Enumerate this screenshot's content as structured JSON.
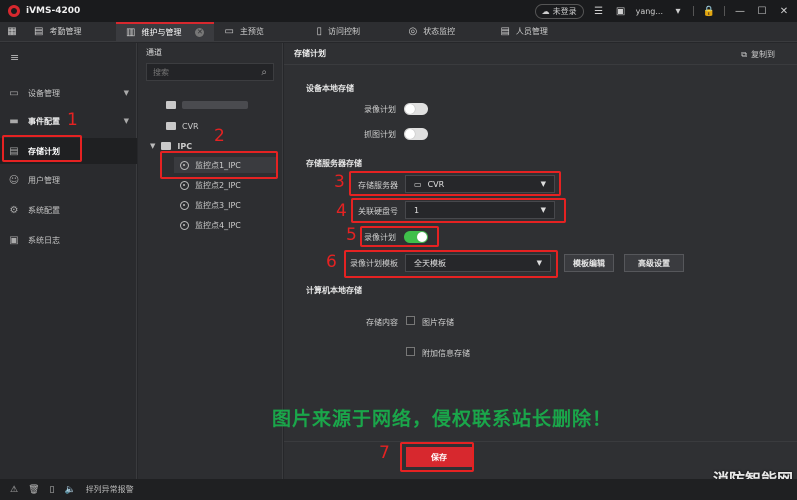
{
  "app": {
    "title": "iVMS-4200"
  },
  "titlebar": {
    "login_status": "未登录",
    "user": "yang..."
  },
  "tabs": [
    {
      "label": "考勤管理",
      "active": false
    },
    {
      "label": "维护与管理",
      "active": true
    },
    {
      "label": "主预览",
      "active": false
    },
    {
      "label": "访问控制",
      "active": false
    },
    {
      "label": "状态监控",
      "active": false
    },
    {
      "label": "人员管理",
      "active": false
    }
  ],
  "leftnav": {
    "items": [
      {
        "label": "设备管理"
      },
      {
        "label": "事件配置"
      },
      {
        "label": "存储计划"
      },
      {
        "label": "用户管理"
      },
      {
        "label": "系统配置"
      },
      {
        "label": "系统日志"
      }
    ]
  },
  "tree": {
    "title": "通道",
    "search_placeholder": "搜索",
    "nodes": [
      {
        "label": "CVR"
      },
      {
        "label": "IPC"
      },
      {
        "label": "监控点1_IPC"
      },
      {
        "label": "监控点2_IPC"
      },
      {
        "label": "监控点3_IPC"
      },
      {
        "label": "监控点4_IPC"
      }
    ]
  },
  "main": {
    "title": "存储计划",
    "copy_to": "复制到",
    "local_storage": {
      "title": "设备本地存储",
      "record_plan": "录像计划",
      "capture_plan": "抓图计划"
    },
    "server_storage": {
      "title": "存储服务器存储",
      "server_label": "存储服务器",
      "server_value": "CVR",
      "disk_label": "关联硬盘号",
      "disk_value": "1",
      "record_plan": "录像计划",
      "template_label": "录像计划模板",
      "template_value": "全天模板",
      "template_edit": "模板编辑",
      "advanced": "高级设置"
    },
    "pc_storage": {
      "title": "计算机本地存储",
      "content_label": "存储内容",
      "picture_storage": "图片存储",
      "extra_info_storage": "附加信息存储"
    },
    "save": "保存"
  },
  "annotations": [
    "1",
    "2",
    "3",
    "4",
    "5",
    "6",
    "7"
  ],
  "watermark": "图片来源于网络，侵权联系站长删除！",
  "corner_mark": "消防智能网",
  "statusbar": {
    "alarm_text": "拌列异常报警"
  },
  "colors": {
    "accent": "#d7282e",
    "toggle_on": "#3fbf4a",
    "annotation": "#e52222",
    "watermark": "#1aa64a"
  }
}
